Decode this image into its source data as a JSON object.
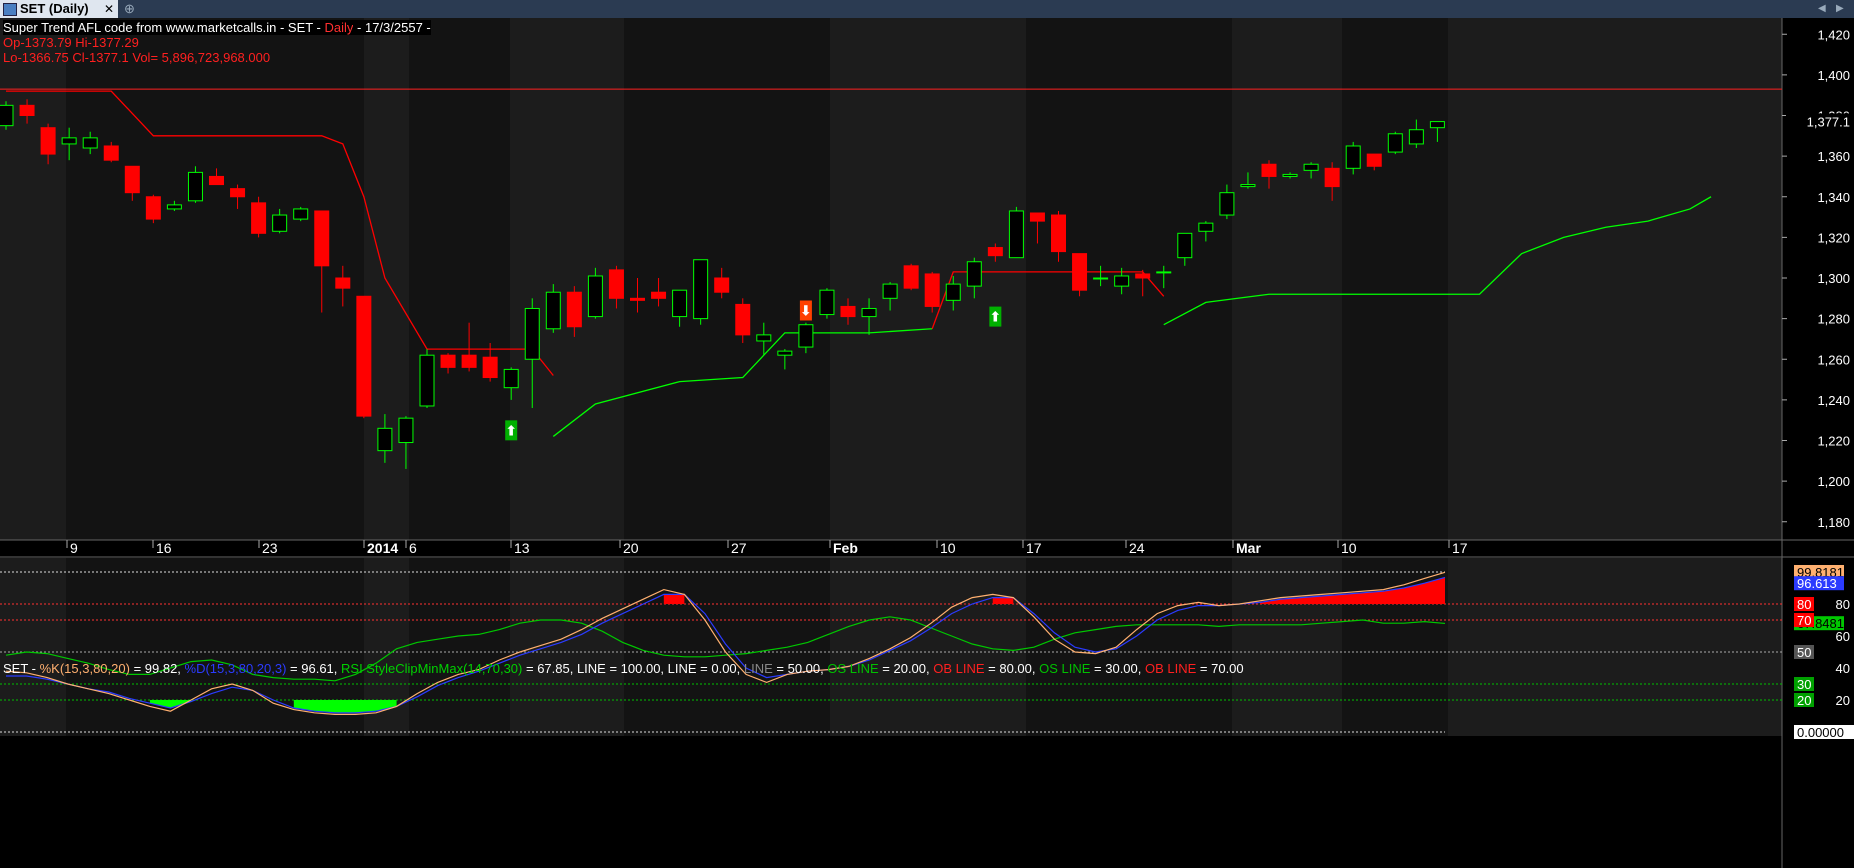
{
  "tab": {
    "title": "SET (Daily)",
    "close": "✕",
    "new_tab": "⊕"
  },
  "nav": {
    "left": "◀",
    "right": "▶"
  },
  "header": {
    "line1_title": "Super Trend AFL code from www.marketcalls.in - SET - ",
    "line1_interval": "Daily",
    "line1_date": " - 17/3/2557 -",
    "line2": "Op-1373.79  Hi-1377.29",
    "line3": "Lo-1366.75  Cl-1377.1  Vol= 5,896,723,968.000"
  },
  "colors": {
    "bull": "#00ff00",
    "bear": "#ff0000",
    "k": "#ffb070",
    "d": "#2b3bff",
    "rsi": "#00c800",
    "bg": "#000000",
    "band": "#1c1c1c"
  },
  "price_axis": {
    "ticks": [
      "1,420",
      "1,400",
      "1,380",
      "1,360",
      "1,340",
      "1,320",
      "1,300",
      "1,280",
      "1,260",
      "1,240",
      "1,220",
      "1,200",
      "1,180"
    ],
    "last": "1,377.1"
  },
  "date_axis": [
    {
      "label": "9",
      "bold": false
    },
    {
      "label": "16",
      "bold": false
    },
    {
      "label": "23",
      "bold": false
    },
    {
      "label": "2014",
      "bold": true
    },
    {
      "label": "6",
      "bold": false
    },
    {
      "label": "13",
      "bold": false
    },
    {
      "label": "20",
      "bold": false
    },
    {
      "label": "27",
      "bold": false
    },
    {
      "label": "Feb",
      "bold": true
    },
    {
      "label": "10",
      "bold": false
    },
    {
      "label": "17",
      "bold": false
    },
    {
      "label": "24",
      "bold": false
    },
    {
      "label": "Mar",
      "bold": true
    },
    {
      "label": "10",
      "bold": false
    },
    {
      "label": "17",
      "bold": false
    }
  ],
  "indicator_legend": [
    {
      "text": "SET - ",
      "color": "#ffffff"
    },
    {
      "text": "%K(15,3,80,20)",
      "color": "#ffb070"
    },
    {
      "text": " = 99.82, ",
      "color": "#ffffff"
    },
    {
      "text": "%D(15,3,80,20,3)",
      "color": "#2b3bff"
    },
    {
      "text": " = 96.61, ",
      "color": "#ffffff"
    },
    {
      "text": "RSI StyleClipMinMax(14,70,30)",
      "color": "#00d000"
    },
    {
      "text": " = 67.85, LINE = 100.00, LINE = 0.00, ",
      "color": "#ffffff"
    },
    {
      "text": "LINE",
      "color": "#888888"
    },
    {
      "text": " = 50.00, ",
      "color": "#ffffff"
    },
    {
      "text": "OS LINE",
      "color": "#00c000"
    },
    {
      "text": " = 20.00, ",
      "color": "#ffffff"
    },
    {
      "text": "OB LINE",
      "color": "#ff2020"
    },
    {
      "text": " = 80.00, ",
      "color": "#ffffff"
    },
    {
      "text": "OS LINE",
      "color": "#00c000"
    },
    {
      "text": " = 30.00, ",
      "color": "#ffffff"
    },
    {
      "text": "OB LINE",
      "color": "#ff2020"
    },
    {
      "text": " = 70.00",
      "color": "#ffffff"
    }
  ],
  "indicator_axis": {
    "k_value": "99.8181",
    "d_value": "96.613",
    "rsi_value": "67.8481",
    "zero_value": "0.00000",
    "ticks": [
      "80",
      "60",
      "40",
      "20"
    ],
    "level_80": "80",
    "level_70": "70",
    "level_50": "50",
    "level_30": "30",
    "level_20": "20"
  },
  "chart_data": {
    "type": "candlestick",
    "price_range": [
      1172,
      1428
    ],
    "candles": [
      [
        1375,
        1387,
        1373,
        1385
      ],
      [
        1385,
        1388,
        1376,
        1380
      ],
      [
        1374,
        1376,
        1356,
        1361
      ],
      [
        1366,
        1374,
        1358,
        1369
      ],
      [
        1364,
        1372,
        1361,
        1369
      ],
      [
        1365,
        1367,
        1357,
        1358
      ],
      [
        1355,
        1355,
        1338,
        1342
      ],
      [
        1340,
        1341,
        1327,
        1329
      ],
      [
        1334,
        1338,
        1333,
        1336
      ],
      [
        1338,
        1355,
        1337,
        1352
      ],
      [
        1350,
        1354,
        1346,
        1346
      ],
      [
        1344,
        1346,
        1334,
        1340
      ],
      [
        1337,
        1340,
        1320,
        1322
      ],
      [
        1323,
        1334,
        1322,
        1331
      ],
      [
        1329,
        1335,
        1328,
        1334
      ],
      [
        1333,
        1333,
        1283,
        1306
      ],
      [
        1300,
        1306,
        1286,
        1295
      ],
      [
        1291,
        1291,
        1231,
        1232
      ],
      [
        1215,
        1233,
        1209,
        1226
      ],
      [
        1219,
        1232,
        1206,
        1231
      ],
      [
        1237,
        1265,
        1236,
        1262
      ],
      [
        1262,
        1263,
        1253,
        1256
      ],
      [
        1262,
        1278,
        1254,
        1256
      ],
      [
        1261,
        1268,
        1249,
        1251
      ],
      [
        1246,
        1256,
        1240,
        1255
      ],
      [
        1260,
        1290,
        1236,
        1285
      ],
      [
        1275,
        1297,
        1273,
        1293
      ],
      [
        1293,
        1296,
        1271,
        1276
      ],
      [
        1281,
        1305,
        1280,
        1301
      ],
      [
        1304,
        1306,
        1285,
        1290
      ],
      [
        1290,
        1300,
        1283,
        1289
      ],
      [
        1293,
        1300,
        1286,
        1290
      ],
      [
        1281,
        1294,
        1276,
        1294
      ],
      [
        1280,
        1309,
        1277,
        1309
      ],
      [
        1300,
        1305,
        1290,
        1293
      ],
      [
        1287,
        1290,
        1268,
        1272
      ],
      [
        1269,
        1278,
        1262,
        1272
      ],
      [
        1262,
        1265,
        1255,
        1264
      ],
      [
        1266,
        1278,
        1263,
        1277
      ],
      [
        1282,
        1295,
        1280,
        1294
      ],
      [
        1286,
        1290,
        1277,
        1281
      ],
      [
        1281,
        1290,
        1272,
        1285
      ],
      [
        1290,
        1298,
        1284,
        1297
      ],
      [
        1306,
        1307,
        1294,
        1295
      ],
      [
        1302,
        1303,
        1283,
        1286
      ],
      [
        1289,
        1301,
        1284,
        1297
      ],
      [
        1296,
        1310,
        1290,
        1308
      ],
      [
        1315,
        1317,
        1308,
        1311
      ],
      [
        1310,
        1335,
        1310,
        1333
      ],
      [
        1332,
        1332,
        1317,
        1328
      ],
      [
        1331,
        1333,
        1308,
        1313
      ],
      [
        1312,
        1312,
        1291,
        1294
      ],
      [
        1300,
        1306,
        1296,
        1300
      ],
      [
        1296,
        1305,
        1292,
        1301
      ],
      [
        1302,
        1304,
        1291,
        1300
      ],
      [
        1303,
        1306,
        1295,
        1303
      ],
      [
        1310,
        1322,
        1306,
        1322
      ],
      [
        1323,
        1328,
        1318,
        1327
      ],
      [
        1331,
        1346,
        1329,
        1342
      ],
      [
        1345,
        1352,
        1344,
        1346
      ],
      [
        1356,
        1358,
        1344,
        1350
      ],
      [
        1350,
        1352,
        1349,
        1351
      ],
      [
        1353,
        1357,
        1349,
        1356
      ],
      [
        1354,
        1357,
        1338,
        1345
      ],
      [
        1354,
        1367,
        1351,
        1365
      ],
      [
        1361,
        1361,
        1353,
        1355
      ],
      [
        1362,
        1372,
        1361,
        1371
      ],
      [
        1366,
        1378,
        1364,
        1373
      ],
      [
        1374,
        1377,
        1367,
        1377
      ]
    ],
    "supertrend_down": [
      [
        0,
        1392
      ],
      [
        5,
        1392
      ],
      [
        7,
        1370
      ],
      [
        15,
        1370
      ],
      [
        16,
        1366
      ],
      [
        17,
        1340
      ],
      [
        18,
        1300
      ],
      [
        20,
        1265
      ],
      [
        25,
        1265
      ],
      [
        26,
        1252
      ]
    ],
    "supertrend_up": [
      [
        26,
        1222
      ],
      [
        28,
        1238
      ],
      [
        32,
        1249
      ],
      [
        35,
        1251
      ],
      [
        37,
        1273
      ],
      [
        41,
        1273
      ],
      [
        44,
        1275
      ]
    ],
    "supertrend_down2": [
      [
        44,
        1275
      ],
      [
        45,
        1303
      ],
      [
        54,
        1303
      ],
      [
        55,
        1291
      ]
    ],
    "supertrend_up2": [
      [
        55,
        1277
      ],
      [
        57,
        1288
      ],
      [
        60,
        1292
      ],
      [
        65,
        1292
      ],
      [
        70,
        1292
      ],
      [
        72,
        1312
      ],
      [
        74,
        1320
      ],
      [
        76,
        1325
      ],
      [
        78,
        1328
      ],
      [
        80,
        1334
      ],
      [
        81,
        1340
      ]
    ],
    "horizontal_line": 1393,
    "signals": [
      {
        "type": "buy",
        "index": 24,
        "price": 1225
      },
      {
        "type": "sell",
        "index": 38,
        "price": 1284
      },
      {
        "type": "buy",
        "index": 47,
        "price": 1281
      }
    ],
    "stoch_k": [
      38,
      37,
      34,
      30,
      27,
      24,
      20,
      16,
      13,
      20,
      27,
      30,
      26,
      18,
      14,
      12,
      11,
      11,
      12,
      16,
      24,
      31,
      36,
      39,
      45,
      50,
      54,
      58,
      64,
      71,
      77,
      83,
      89,
      86,
      70,
      50,
      36,
      31,
      36,
      38,
      39,
      41,
      46,
      52,
      59,
      68,
      78,
      84,
      86,
      84,
      72,
      58,
      50,
      49,
      53,
      64,
      74,
      79,
      81,
      79,
      80,
      82,
      84,
      85,
      86,
      87,
      88,
      89,
      92,
      96,
      99.8
    ],
    "stoch_d": [
      35,
      35,
      33,
      30,
      27,
      25,
      21,
      18,
      15,
      19,
      24,
      28,
      26,
      20,
      15,
      13,
      12,
      12,
      13,
      16,
      22,
      29,
      34,
      38,
      43,
      48,
      52,
      56,
      61,
      68,
      74,
      80,
      86,
      86,
      74,
      55,
      40,
      34,
      36,
      38,
      39,
      41,
      45,
      51,
      57,
      65,
      74,
      80,
      84,
      84,
      74,
      62,
      53,
      50,
      52,
      60,
      70,
      76,
      79,
      79,
      80,
      81,
      83,
      84,
      85,
      86,
      87,
      88,
      90,
      93,
      96.6
    ],
    "rsi": [
      48,
      50,
      49,
      46,
      43,
      39,
      36,
      36,
      40,
      44,
      45,
      42,
      36,
      34,
      33,
      33,
      32,
      36,
      43,
      52,
      56,
      58,
      60,
      61,
      64,
      68,
      70,
      70,
      68,
      63,
      56,
      51,
      48,
      47,
      47,
      48,
      49,
      51,
      53,
      56,
      61,
      66,
      70,
      72,
      70,
      65,
      60,
      55,
      52,
      51,
      53,
      58,
      62,
      64,
      66,
      67,
      67,
      67,
      67,
      66,
      67,
      67,
      67,
      67,
      68,
      69,
      70,
      68,
      68,
      69,
      67.85
    ]
  }
}
